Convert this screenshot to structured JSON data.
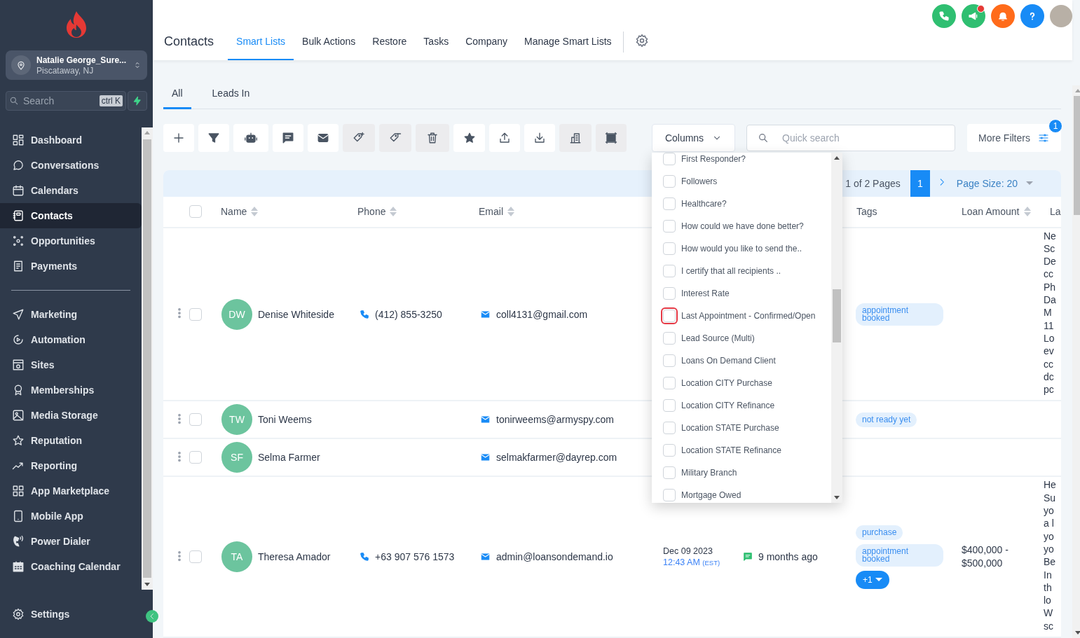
{
  "sidebar": {
    "account": {
      "name": "Natalie George_Sure...",
      "location": "Piscataway, NJ"
    },
    "search": {
      "placeholder": "Search",
      "shortcut": "ctrl K"
    },
    "items": [
      {
        "label": "Dashboard",
        "selected": false
      },
      {
        "label": "Conversations",
        "selected": false
      },
      {
        "label": "Calendars",
        "selected": false
      },
      {
        "label": "Contacts",
        "selected": true
      },
      {
        "label": "Opportunities",
        "selected": false
      },
      {
        "label": "Payments",
        "selected": false
      }
    ],
    "items_secondary": [
      {
        "label": "Marketing",
        "selected": false
      },
      {
        "label": "Automation",
        "selected": false
      },
      {
        "label": "Sites",
        "selected": false
      },
      {
        "label": "Memberships",
        "selected": false
      },
      {
        "label": "Media Storage",
        "selected": false
      },
      {
        "label": "Reputation",
        "selected": false
      },
      {
        "label": "Reporting",
        "selected": false
      },
      {
        "label": "App Marketplace",
        "selected": false
      },
      {
        "label": "Mobile App",
        "selected": false
      },
      {
        "label": "Power Dialer",
        "selected": false
      },
      {
        "label": "Coaching Calendar",
        "selected": false
      }
    ],
    "settings": "Settings"
  },
  "header": {
    "title": "Contacts",
    "tabs": [
      {
        "label": "Smart Lists",
        "selected": true
      },
      {
        "label": "Bulk Actions",
        "selected": false
      },
      {
        "label": "Restore",
        "selected": false
      },
      {
        "label": "Tasks",
        "selected": false
      },
      {
        "label": "Company",
        "selected": false
      },
      {
        "label": "Manage Smart Lists",
        "selected": false
      }
    ],
    "notification_dot": true
  },
  "subtabs": [
    {
      "label": "All",
      "selected": true
    },
    {
      "label": "Leads In",
      "selected": false
    }
  ],
  "toolbar": [
    {
      "disabled": false
    },
    {
      "disabled": false
    },
    {
      "disabled": false
    },
    {
      "disabled": false
    },
    {
      "disabled": false
    },
    {
      "disabled": true
    },
    {
      "disabled": true
    },
    {
      "disabled": true
    },
    {
      "disabled": false
    },
    {
      "disabled": false
    },
    {
      "disabled": false
    },
    {
      "disabled": true
    },
    {
      "disabled": true
    }
  ],
  "columns_button": "Columns",
  "quick_search": {
    "placeholder": "Quick search"
  },
  "more_filters": {
    "label": "More Filters",
    "badge": "1"
  },
  "columns_menu": [
    {
      "label": "First Responder?",
      "checked": false,
      "focused": false
    },
    {
      "label": "Followers",
      "checked": false,
      "focused": false
    },
    {
      "label": "Healthcare?",
      "checked": false,
      "focused": false
    },
    {
      "label": "How could we have done better?",
      "checked": false,
      "focused": false
    },
    {
      "label": "How would you like to send the..",
      "checked": false,
      "focused": false
    },
    {
      "label": "I certify that all recipients ..",
      "checked": false,
      "focused": false
    },
    {
      "label": "Interest Rate",
      "checked": false,
      "focused": false
    },
    {
      "label": "Last Appointment - Confirmed/Open",
      "checked": false,
      "focused": true
    },
    {
      "label": "Lead Source (Multi)",
      "checked": false,
      "focused": false
    },
    {
      "label": "Loans On Demand Client",
      "checked": false,
      "focused": false
    },
    {
      "label": "Location CITY Purchase",
      "checked": false,
      "focused": false
    },
    {
      "label": "Location CITY Refinance",
      "checked": false,
      "focused": false
    },
    {
      "label": "Location STATE Purchase",
      "checked": false,
      "focused": false
    },
    {
      "label": "Location STATE Refinance",
      "checked": false,
      "focused": false
    },
    {
      "label": "Military Branch",
      "checked": false,
      "focused": false
    },
    {
      "label": "Mortgage Owed",
      "checked": false,
      "focused": false
    }
  ],
  "pagination": {
    "summary": "1 of 2 Pages",
    "current_page": "1",
    "page_size": "Page Size: 20"
  },
  "table": {
    "select_all_checked": false,
    "columns": [
      {
        "label": "Name",
        "sortable": true
      },
      {
        "label": "Phone",
        "sortable": true
      },
      {
        "label": "Email",
        "sortable": true
      },
      {
        "label": "Tags",
        "sortable": false
      },
      {
        "label": "Loan Amount",
        "sortable": true
      },
      {
        "label": "La",
        "sortable": false
      }
    ],
    "rows": [
      {
        "checked": false,
        "initials": "DW",
        "name": "Denise Whiteside",
        "phone": "(412) 855-3250",
        "email": "coll4131@gmail.com",
        "tags": [
          "appointment booked"
        ],
        "fragments": [
          "Ne",
          "Sc",
          "De",
          "cc",
          "Ph",
          "Da",
          "M",
          "11",
          "Lo",
          "ev",
          "cc",
          "dc",
          "pc"
        ]
      },
      {
        "checked": false,
        "initials": "TW",
        "name": "Toni Weems",
        "email": "tonirweems@armyspy.com",
        "tags": [
          "not ready yet"
        ]
      },
      {
        "checked": false,
        "initials": "SF",
        "name": "Selma Farmer",
        "email": "selmakfarmer@dayrep.com"
      },
      {
        "checked": false,
        "initials": "TA",
        "name": "Theresa Amador",
        "phone": "+63 907 576 1573",
        "email": "admin@loansondemand.io",
        "date": "Dec 09 2023",
        "time": "12:43 AM",
        "timezone": "(EST)",
        "activity": "9 months ago",
        "tags": [
          "purchase",
          "appointment booked"
        ],
        "more_tags": "+1",
        "loan": "$400,000 - $500,000",
        "fragments": [
          "He",
          "Su",
          "yo",
          "a l",
          "yo",
          "yo",
          "Be",
          "In",
          "th",
          "lo",
          "W",
          "sc"
        ]
      }
    ]
  }
}
